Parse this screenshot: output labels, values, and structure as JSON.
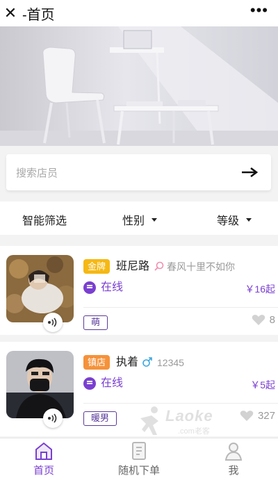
{
  "titlebar": {
    "title": "-首页",
    "close_glyph": "✕",
    "more_glyph": "•••"
  },
  "search": {
    "placeholder": "搜索店员"
  },
  "filters": {
    "smart": "智能筛选",
    "gender": "性别",
    "level": "等级"
  },
  "staff": [
    {
      "rank": "金牌",
      "rank_color": "#f5b814",
      "name": "班尼路",
      "gender_icon": "female-search-icon",
      "signature": "春风十里不如你",
      "status": "在线",
      "price": "￥16起",
      "tag": "萌",
      "likes": "8"
    },
    {
      "rank": "镇店",
      "rank_color": "#f5923a",
      "name": "执着",
      "gender_icon": "male-icon",
      "signature": "12345",
      "status": "在线",
      "price": "￥5起",
      "tag": "暖男",
      "likes": "327"
    }
  ],
  "watermark": {
    "text": "Laoke",
    "sub": ".com老客"
  },
  "nav": {
    "home": "首页",
    "random_order": "随机下单",
    "me": "我"
  },
  "colors": {
    "accent": "#7a3fd0",
    "gold": "#f5b814",
    "orange": "#f5923a"
  }
}
